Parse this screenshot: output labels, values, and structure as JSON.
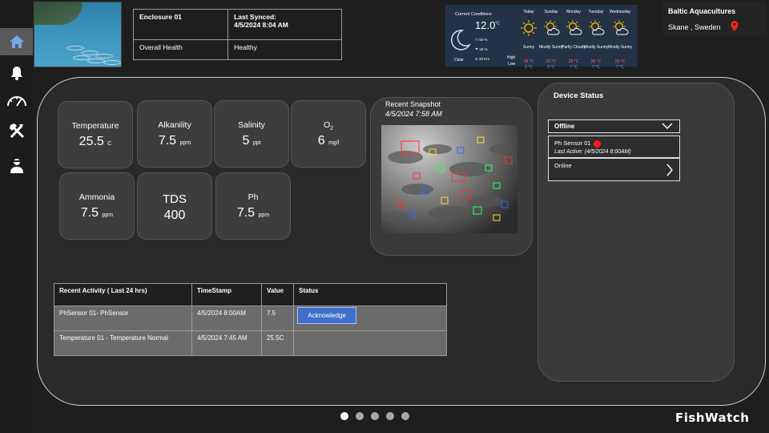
{
  "enclosure": {
    "name": "Enclosure 01",
    "synced_label": "Last Synced:",
    "synced_value": "4/5/2024 8:04 AM",
    "health_label": "Overall Health",
    "health_value": "Healthy"
  },
  "weather": {
    "current_label": "Current Conditions",
    "temp": "12.0",
    "temp_unit": "°C",
    "condition": "Clear",
    "humidity": "50 %",
    "rain": "19 %",
    "wind": "20 Km",
    "high_label": "High",
    "low_label": "Low",
    "days": [
      {
        "name": "Today",
        "cond": "Sunny",
        "hi": "16 °C",
        "lo": "2 °C"
      },
      {
        "name": "Sunday",
        "cond": "Mostly Sunny",
        "hi": "23 °C",
        "lo": "3 °C"
      },
      {
        "name": "Monday",
        "cond": "Partly Cloudy",
        "hi": "23 °C",
        "lo": "7 °C"
      },
      {
        "name": "Tuesday",
        "cond": "Mostly Sunny",
        "hi": "25 °C",
        "lo": "7 °C"
      },
      {
        "name": "Wednesday",
        "cond": "Mostly Sunny",
        "hi": "23 °C",
        "lo": "7 °C"
      }
    ]
  },
  "company": {
    "name": "Baltic Aquacultures",
    "location": "Skane , Sweden"
  },
  "metrics": {
    "temperature": {
      "label": "Temperature",
      "value": "25.5",
      "unit": "C"
    },
    "alkalinity": {
      "label": "Alkanility",
      "value": "7.5",
      "unit": "ppm"
    },
    "salinity": {
      "label": "Salinity",
      "value": "5",
      "unit": "ppt"
    },
    "o2": {
      "label": "O",
      "sub": "2",
      "value": "6",
      "unit": "mg/l"
    },
    "ammonia": {
      "label": "Ammonia",
      "value": "7.5",
      "unit": "ppm"
    },
    "tds": {
      "label": "TDS",
      "value": "400"
    },
    "ph": {
      "label": "Ph",
      "value": "7.5",
      "unit": "ppm"
    }
  },
  "snapshot": {
    "title": "Recent Snapshot",
    "time": "4/5/2024 7:58 AM"
  },
  "device_status": {
    "title": "Device Status",
    "dropdown": "Offline",
    "offline_item": {
      "name": "Ph Sensor 01",
      "last_active": "Last Active: (4/5/2024 8:00AM)"
    },
    "online_item": "Online"
  },
  "activity": {
    "headers": [
      "Recent Activity ( Last 24 hrs)",
      "TimeStamp",
      "Value",
      "Status"
    ],
    "rows": [
      {
        "name": "PhSensor 01- PhSensor",
        "time": "4/5/2024 8:00AM",
        "value": "7.5",
        "action": "Acknowledge"
      },
      {
        "name": "Temperature 01 - Temperature Normal",
        "time": "4/5/2024 7:45 AM",
        "value": "25.5C",
        "action": ""
      }
    ]
  },
  "pagination": {
    "total": 5,
    "current": 1
  },
  "brand": "FishWatch",
  "colors": {
    "accent": "#3f6fc7",
    "alert": "#ff1a1a",
    "weather_bg": "#233246"
  }
}
